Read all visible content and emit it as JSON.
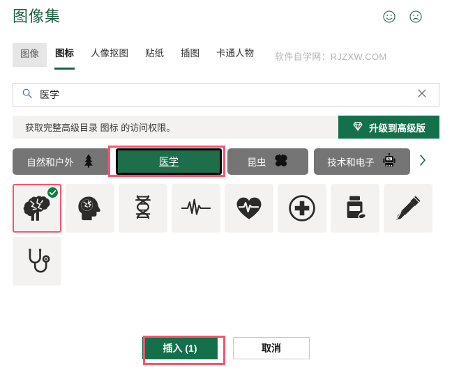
{
  "header": {
    "title": "图像集",
    "feedback": [
      {
        "name": "smiley-happy-icon",
        "label": "满意"
      },
      {
        "name": "smiley-sad-icon",
        "label": "不满意"
      }
    ]
  },
  "tabs": {
    "items": [
      {
        "label": "图像",
        "state": "ghost"
      },
      {
        "label": "图标",
        "state": "active"
      },
      {
        "label": "人像抠图",
        "state": "normal"
      },
      {
        "label": "贴纸",
        "state": "normal"
      },
      {
        "label": "插图",
        "state": "normal"
      },
      {
        "label": "卡通人物",
        "state": "normal"
      }
    ],
    "watermark": "软件自学网：RJZXW.COM"
  },
  "search": {
    "value": "医学",
    "placeholder": "搜索",
    "icon": "search-icon",
    "clear_icon": "close-icon"
  },
  "banner": {
    "text": "获取完整高级目录 图标 的访问权限。",
    "button_label": "升级到高级版",
    "button_icon": "gem-icon",
    "button_color": "#13704b",
    "background": "#f3f2f1"
  },
  "chips": {
    "items": [
      {
        "label": "自然和户外",
        "icon": "pine-tree-icon",
        "selected": false
      },
      {
        "label": "医学",
        "icon": "",
        "selected": true
      },
      {
        "label": "昆虫",
        "icon": "butterfly-icon",
        "selected": false
      },
      {
        "label": "技术和电子",
        "icon": "robot-icon",
        "selected": false
      }
    ],
    "next_icon": "chevron-right-icon",
    "chip_color": "#757575",
    "selected_color": "#1d6e4b",
    "highlight_color": "#f9536b"
  },
  "icon_grid": {
    "items": [
      {
        "name": "brain-icon",
        "label": "大脑",
        "selected": true
      },
      {
        "name": "head-brain-icon",
        "label": "头部大脑",
        "selected": false
      },
      {
        "name": "dna-icon",
        "label": "DNA",
        "selected": false
      },
      {
        "name": "heartbeat-line-icon",
        "label": "心电图",
        "selected": false
      },
      {
        "name": "heart-pulse-icon",
        "label": "心脏脉搏",
        "selected": false
      },
      {
        "name": "medical-cross-icon",
        "label": "医疗十字",
        "selected": false
      },
      {
        "name": "pill-bottle-icon",
        "label": "药瓶",
        "selected": false
      },
      {
        "name": "syringe-icon",
        "label": "注射器",
        "selected": false
      },
      {
        "name": "stethoscope-icon",
        "label": "听诊器",
        "selected": false
      }
    ],
    "badge_icon": "check-circle-icon",
    "selected_count": 1
  },
  "footer": {
    "insert_label": "插入 (1)",
    "cancel_label": "取消"
  }
}
